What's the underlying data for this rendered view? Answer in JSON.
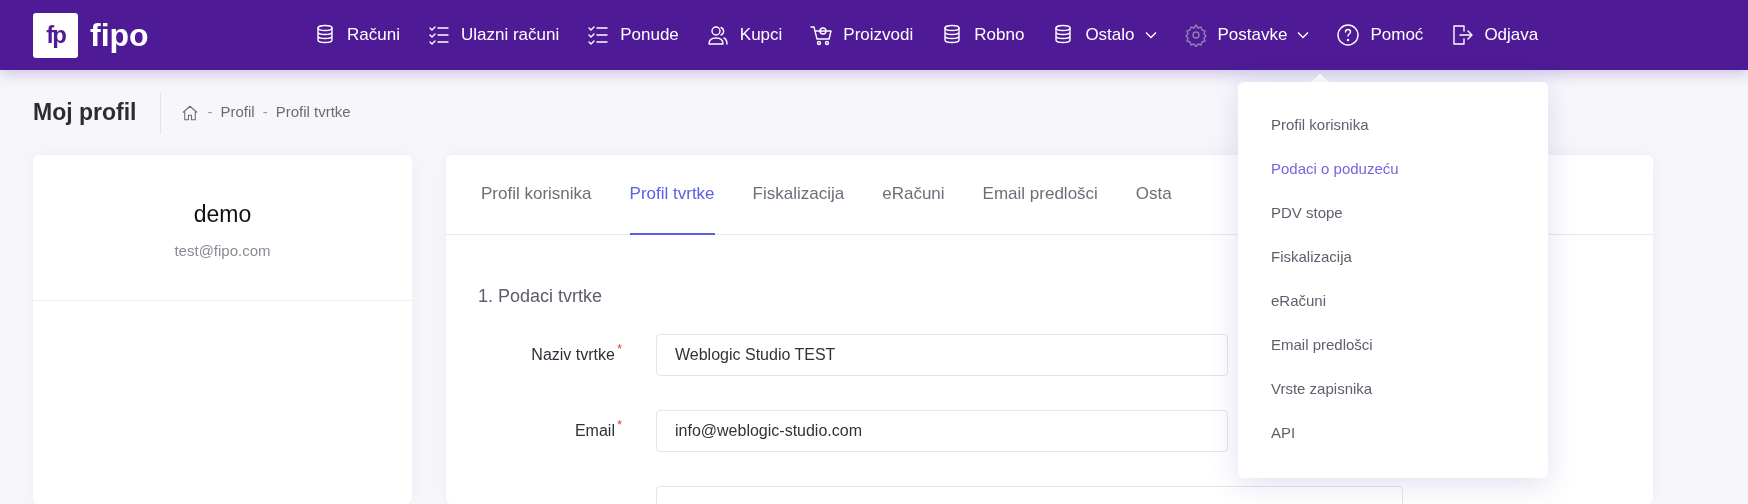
{
  "logo": {
    "mark": "fp",
    "name": "fipo"
  },
  "nav": [
    {
      "label": "Računi",
      "dropdown": false,
      "expanded": false
    },
    {
      "label": "Ulazni računi",
      "dropdown": false,
      "expanded": false
    },
    {
      "label": "Ponude",
      "dropdown": false,
      "expanded": false
    },
    {
      "label": "Kupci",
      "dropdown": false,
      "expanded": false
    },
    {
      "label": "Proizvodi",
      "dropdown": false,
      "expanded": false
    },
    {
      "label": "Robno",
      "dropdown": false,
      "expanded": false
    },
    {
      "label": "Ostalo",
      "dropdown": true,
      "expanded": false
    },
    {
      "label": "Postavke",
      "dropdown": true,
      "expanded": true
    },
    {
      "label": "Pomoć",
      "dropdown": false,
      "expanded": false
    },
    {
      "label": "Odjava",
      "dropdown": false,
      "expanded": false
    }
  ],
  "page_title": "Moj profil",
  "breadcrumb": [
    {
      "separator": "-",
      "label": "Profil"
    },
    {
      "separator": "-",
      "label": "Profil tvrtke"
    }
  ],
  "profile": {
    "name": "demo",
    "email": "test@fipo.com"
  },
  "tabs": [
    {
      "label": "Profil korisnika",
      "selected": false
    },
    {
      "label": "Profil tvrtke",
      "selected": true
    },
    {
      "label": "Fiskalizacija",
      "selected": false
    },
    {
      "label": "eRačuni",
      "selected": false
    },
    {
      "label": "Email predlošci",
      "selected": false
    },
    {
      "label": "Osta",
      "selected": false
    }
  ],
  "section_title": "1. Podaci tvrtke",
  "fields": [
    {
      "label": "Naziv tvrtke",
      "required_mark": "*",
      "value": "Weblogic Studio TEST"
    },
    {
      "label": "Email",
      "required_mark": "*",
      "value": "info@weblogic-studio.com"
    }
  ],
  "dropdown_menu": [
    {
      "label": "Profil korisnika",
      "selected": false
    },
    {
      "label": "Podaci o poduzeću",
      "selected": true
    },
    {
      "label": "PDV stope",
      "selected": false
    },
    {
      "label": "Fiskalizacija",
      "selected": false
    },
    {
      "label": "eRačuni",
      "selected": false
    },
    {
      "label": "Email predlošci",
      "selected": false
    },
    {
      "label": "Vrste zapisnika",
      "selected": false
    },
    {
      "label": "API",
      "selected": false
    }
  ]
}
